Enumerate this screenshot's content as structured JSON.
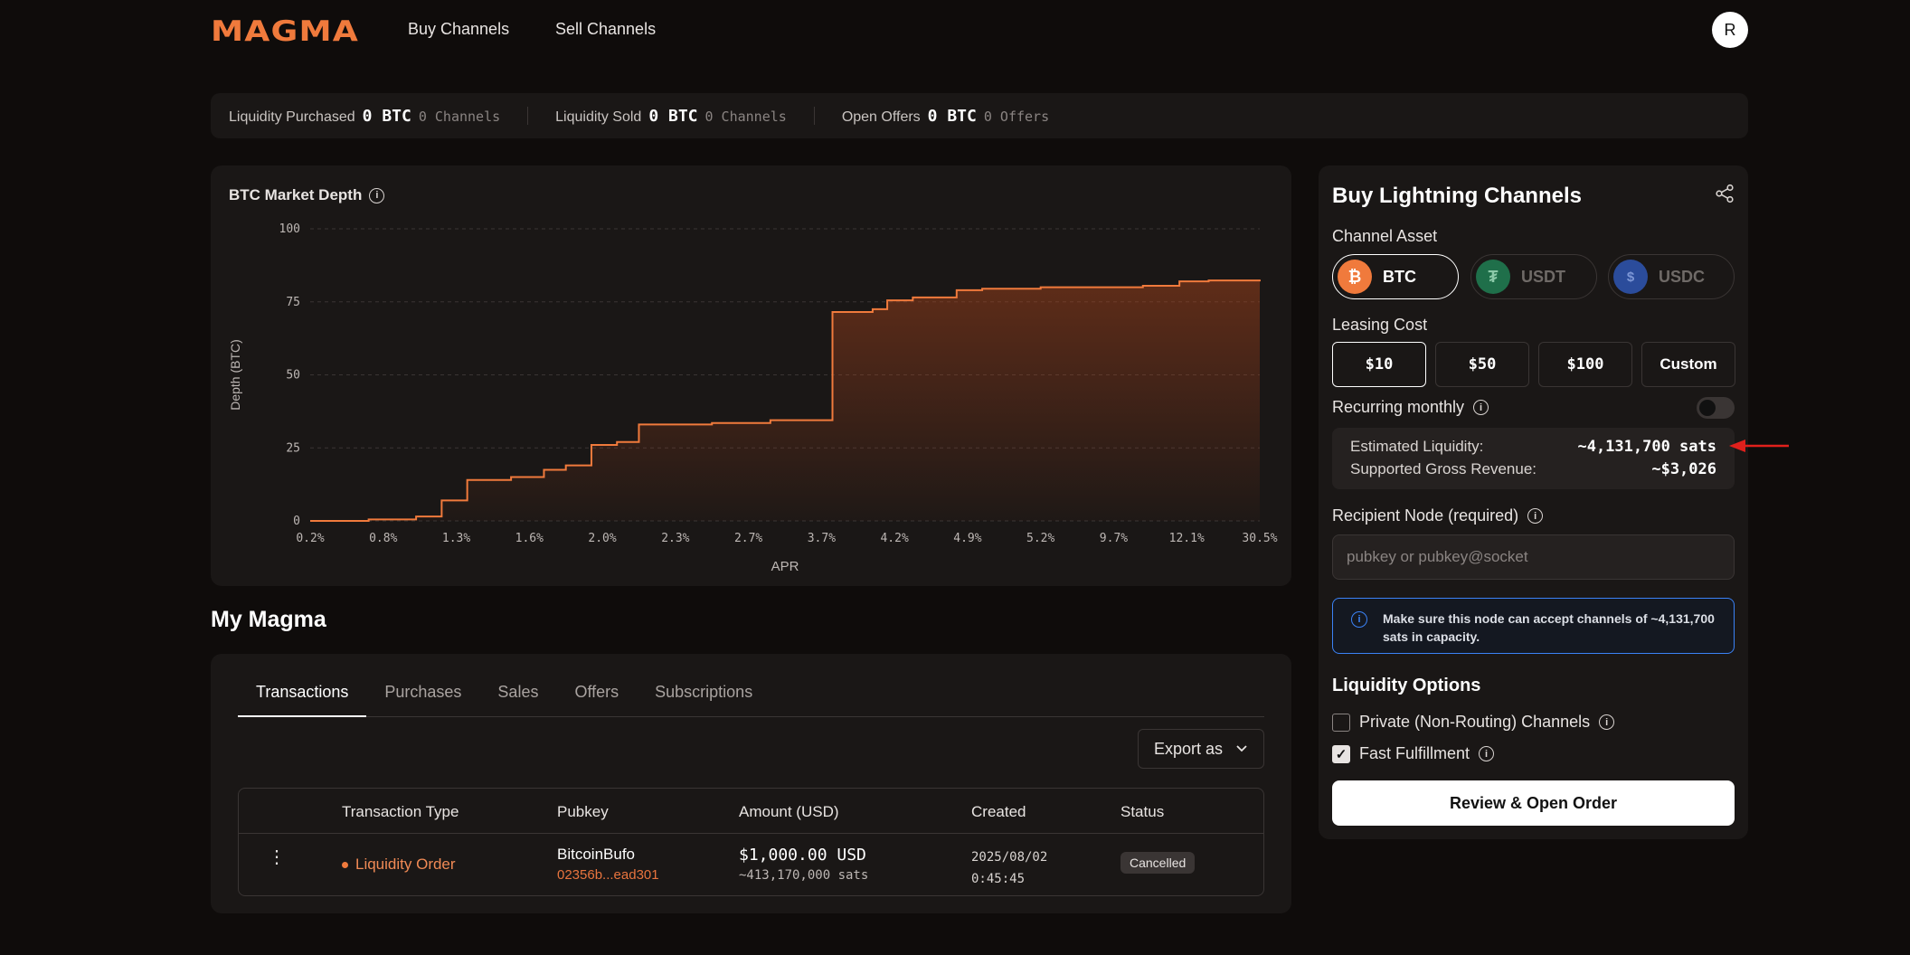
{
  "header": {
    "logo_text": "MAGMA",
    "nav": [
      "Buy Channels",
      "Sell Channels"
    ],
    "avatar_initial": "R"
  },
  "stats": [
    {
      "label": "Liquidity Purchased",
      "value": "0 BTC",
      "sub": "0 Channels"
    },
    {
      "label": "Liquidity Sold",
      "value": "0 BTC",
      "sub": "0 Channels"
    },
    {
      "label": "Open Offers",
      "value": "0 BTC",
      "sub": "0 Offers"
    }
  ],
  "chart_card": {
    "title": "BTC Market Depth"
  },
  "chart_data": {
    "type": "area",
    "title": "BTC Market Depth",
    "xlabel": "APR",
    "ylabel": "Depth (BTC)",
    "ylim": [
      0,
      100
    ],
    "yticks": [
      "0",
      "25",
      "50",
      "75",
      "100"
    ],
    "xticks": [
      "0.2%",
      "0.8%",
      "1.3%",
      "1.6%",
      "2.0%",
      "2.3%",
      "2.7%",
      "3.7%",
      "4.2%",
      "4.9%",
      "5.2%",
      "9.7%",
      "12.1%",
      "30.5%"
    ],
    "grid": true,
    "color": "#f07a3c",
    "steps": [
      {
        "x": 0.0,
        "y": 0
      },
      {
        "x": 0.8,
        "y": 0.5
      },
      {
        "x": 1.45,
        "y": 1.5
      },
      {
        "x": 1.8,
        "y": 7
      },
      {
        "x": 2.15,
        "y": 14
      },
      {
        "x": 2.75,
        "y": 15
      },
      {
        "x": 3.2,
        "y": 17.5
      },
      {
        "x": 3.5,
        "y": 19
      },
      {
        "x": 3.85,
        "y": 26
      },
      {
        "x": 4.2,
        "y": 27
      },
      {
        "x": 4.5,
        "y": 33
      },
      {
        "x": 5.5,
        "y": 33.5
      },
      {
        "x": 6.3,
        "y": 34.5
      },
      {
        "x": 7.15,
        "y": 71.5
      },
      {
        "x": 7.7,
        "y": 72.5
      },
      {
        "x": 7.9,
        "y": 75.5
      },
      {
        "x": 8.25,
        "y": 76.5
      },
      {
        "x": 8.85,
        "y": 79
      },
      {
        "x": 9.2,
        "y": 79.5
      },
      {
        "x": 10.0,
        "y": 80
      },
      {
        "x": 11.4,
        "y": 80.5
      },
      {
        "x": 11.9,
        "y": 82
      },
      {
        "x": 12.3,
        "y": 82.3
      },
      {
        "x": 13.0,
        "y": 82.6
      }
    ]
  },
  "my_magma": {
    "title": "My Magma",
    "tabs": [
      "Transactions",
      "Purchases",
      "Sales",
      "Offers",
      "Subscriptions"
    ],
    "export_label": "Export as",
    "columns": [
      "Transaction Type",
      "Pubkey",
      "Amount (USD)",
      "Created",
      "Status"
    ],
    "rows": [
      {
        "type": "Liquidity Order",
        "pubkey_name": "BitcoinBufo",
        "pubkey_hash": "02356b...ead301",
        "amount": "$1,000.00 USD",
        "amount_sats": "~413,170,000 sats",
        "created_date": "2025/08/02",
        "created_time": "0:45:45",
        "status": "Cancelled"
      }
    ]
  },
  "panel": {
    "title": "Buy Lightning Channels",
    "asset_label": "Channel Asset",
    "assets": [
      {
        "name": "BTC",
        "symbol": "₿",
        "color": "#f7931a"
      },
      {
        "name": "USDT",
        "symbol": "₮",
        "color": "#1f6f4a"
      },
      {
        "name": "USDC",
        "symbol": "$",
        "color": "#2b4c9b"
      }
    ],
    "cost_label": "Leasing Cost",
    "costs": [
      "$10",
      "$50",
      "$100",
      "Custom"
    ],
    "recurring_label": "Recurring monthly",
    "est_liquidity_label": "Estimated Liquidity:",
    "est_liquidity_value": "~4,131,700 sats",
    "revenue_label": "Supported Gross Revenue:",
    "revenue_value": "~$3,026",
    "recipient_label": "Recipient Node (required)",
    "recipient_placeholder": "pubkey or pubkey@socket",
    "notice": "Make sure this node can accept channels of ~4,131,700 sats in capacity.",
    "options_title": "Liquidity Options",
    "option_private": "Private (Non-Routing) Channels",
    "option_fast": "Fast Fulfillment",
    "review_label": "Review & Open Order"
  }
}
